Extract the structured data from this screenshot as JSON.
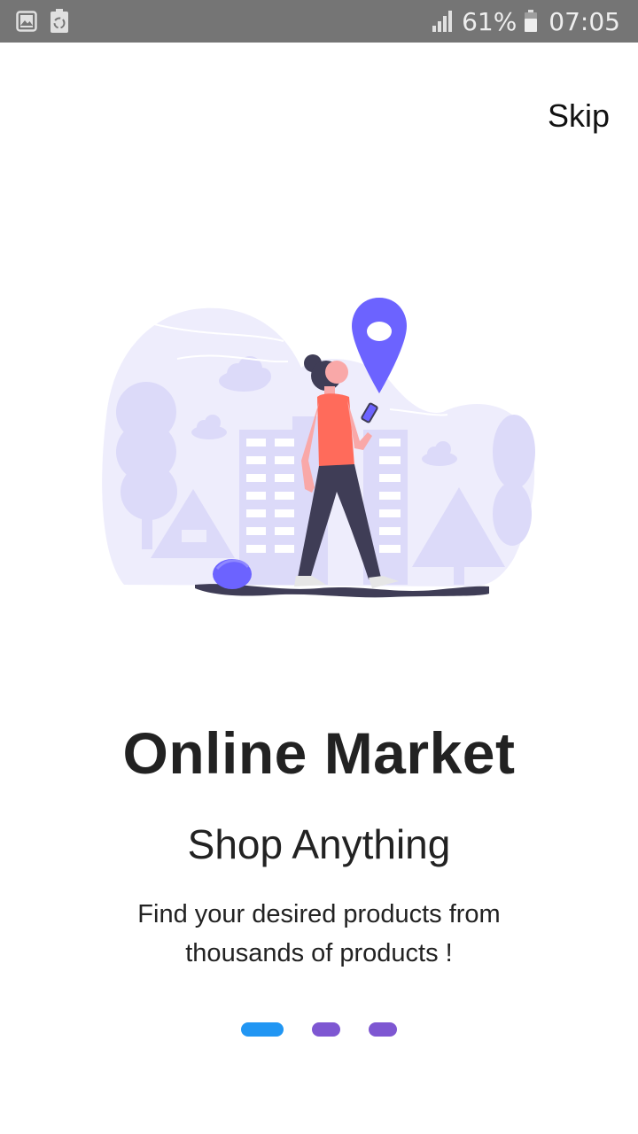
{
  "status_bar": {
    "battery_percent": "61%",
    "time": "07:05",
    "icons": [
      "gallery-icon",
      "battery-saver-icon",
      "signal-icon",
      "battery-icon"
    ]
  },
  "onboarding": {
    "skip_label": "Skip",
    "title": "Online Market",
    "subtitle": "Shop Anything",
    "description": "Find your desired products from thousands of products !",
    "page_indicator": {
      "current": 1,
      "total": 3
    }
  },
  "colors": {
    "status_bar_bg": "#757575",
    "accent_active": "#2196F3",
    "accent_inactive": "#7E57D2",
    "illustration_primary": "#6C63FF",
    "illustration_bg": "#EEEDFC",
    "text": "#222222"
  }
}
